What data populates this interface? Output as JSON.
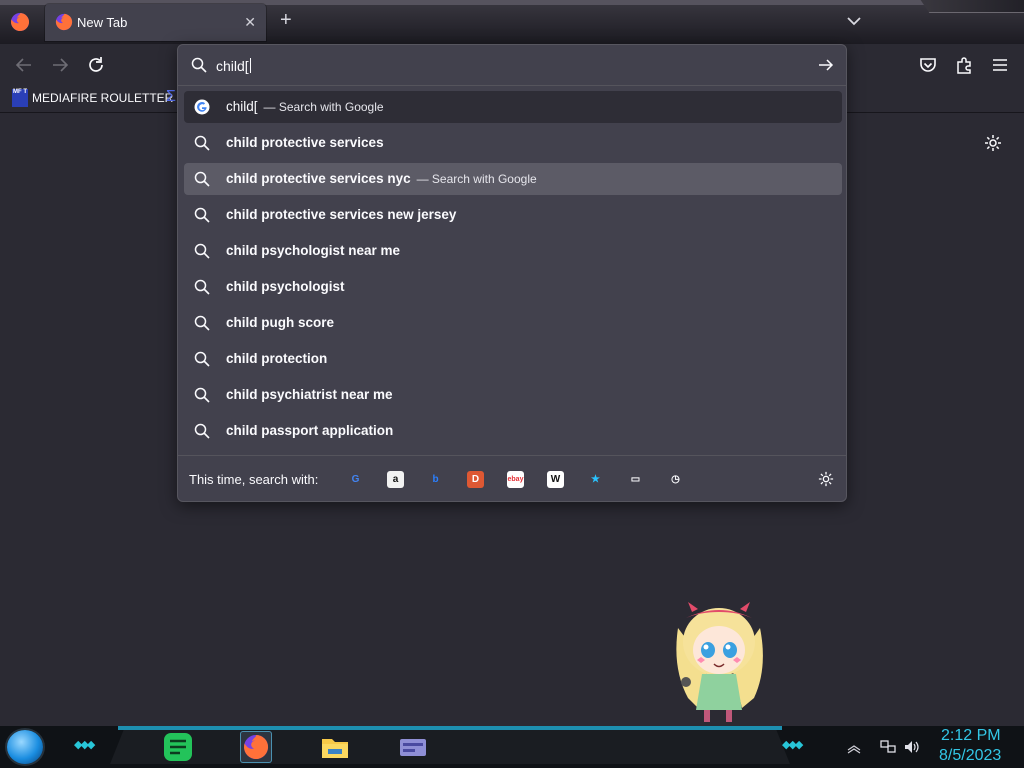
{
  "tab": {
    "title": "New Tab",
    "close": "✕"
  },
  "newtab": "+",
  "bookmarks": {
    "item1": "MEDIAFIRE ROULETTER",
    "item1_icon": "MF T"
  },
  "urlbar": {
    "query": "child[",
    "suggestions": [
      {
        "text": "child[",
        "action": "— Search with Google",
        "icon": "google-icon",
        "bold": false,
        "state": "first"
      },
      {
        "text": "child protective services",
        "action": "",
        "icon": "search-icon",
        "bold": true,
        "state": ""
      },
      {
        "text": "child protective services nyc",
        "action": "— Search with Google",
        "icon": "search-icon",
        "bold": true,
        "state": "hover"
      },
      {
        "text": "child protective services new jersey",
        "action": "",
        "icon": "search-icon",
        "bold": true,
        "state": ""
      },
      {
        "text": "child psychologist near me",
        "action": "",
        "icon": "search-icon",
        "bold": true,
        "state": ""
      },
      {
        "text": "child psychologist",
        "action": "",
        "icon": "search-icon",
        "bold": true,
        "state": ""
      },
      {
        "text": "child pugh score",
        "action": "",
        "icon": "search-icon",
        "bold": true,
        "state": ""
      },
      {
        "text": "child protection",
        "action": "",
        "icon": "search-icon",
        "bold": true,
        "state": ""
      },
      {
        "text": "child psychiatrist near me",
        "action": "",
        "icon": "search-icon",
        "bold": true,
        "state": ""
      },
      {
        "text": "child passport application",
        "action": "",
        "icon": "search-icon",
        "bold": true,
        "state": ""
      }
    ],
    "oneoff_label": "This time, search with:",
    "engines": [
      {
        "name": "google-icon",
        "glyph": "G",
        "color": "#4285f4",
        "bg": "transparent"
      },
      {
        "name": "amazon-icon",
        "glyph": "a",
        "color": "#111111",
        "bg": "#f2f2f2"
      },
      {
        "name": "bing-icon",
        "glyph": "b",
        "color": "#2a7fff",
        "bg": "transparent"
      },
      {
        "name": "duckduckgo-icon",
        "glyph": "D",
        "color": "#ffffff",
        "bg": "#de5833"
      },
      {
        "name": "ebay-icon",
        "glyph": "ebay",
        "color": "#e53238",
        "bg": "#ffffff"
      },
      {
        "name": "wikipedia-icon",
        "glyph": "W",
        "color": "#111111",
        "bg": "#ffffff"
      },
      {
        "name": "bookmarks-star-icon",
        "glyph": "★",
        "color": "#2ac3ff",
        "bg": "transparent"
      },
      {
        "name": "tabs-icon",
        "glyph": "▭",
        "color": "#fbfbfe",
        "bg": "transparent"
      },
      {
        "name": "history-icon",
        "glyph": "◷",
        "color": "#fbfbfe",
        "bg": "transparent"
      }
    ]
  },
  "taskbar": {
    "time": "2:12 PM",
    "date": "8/5/2023"
  }
}
